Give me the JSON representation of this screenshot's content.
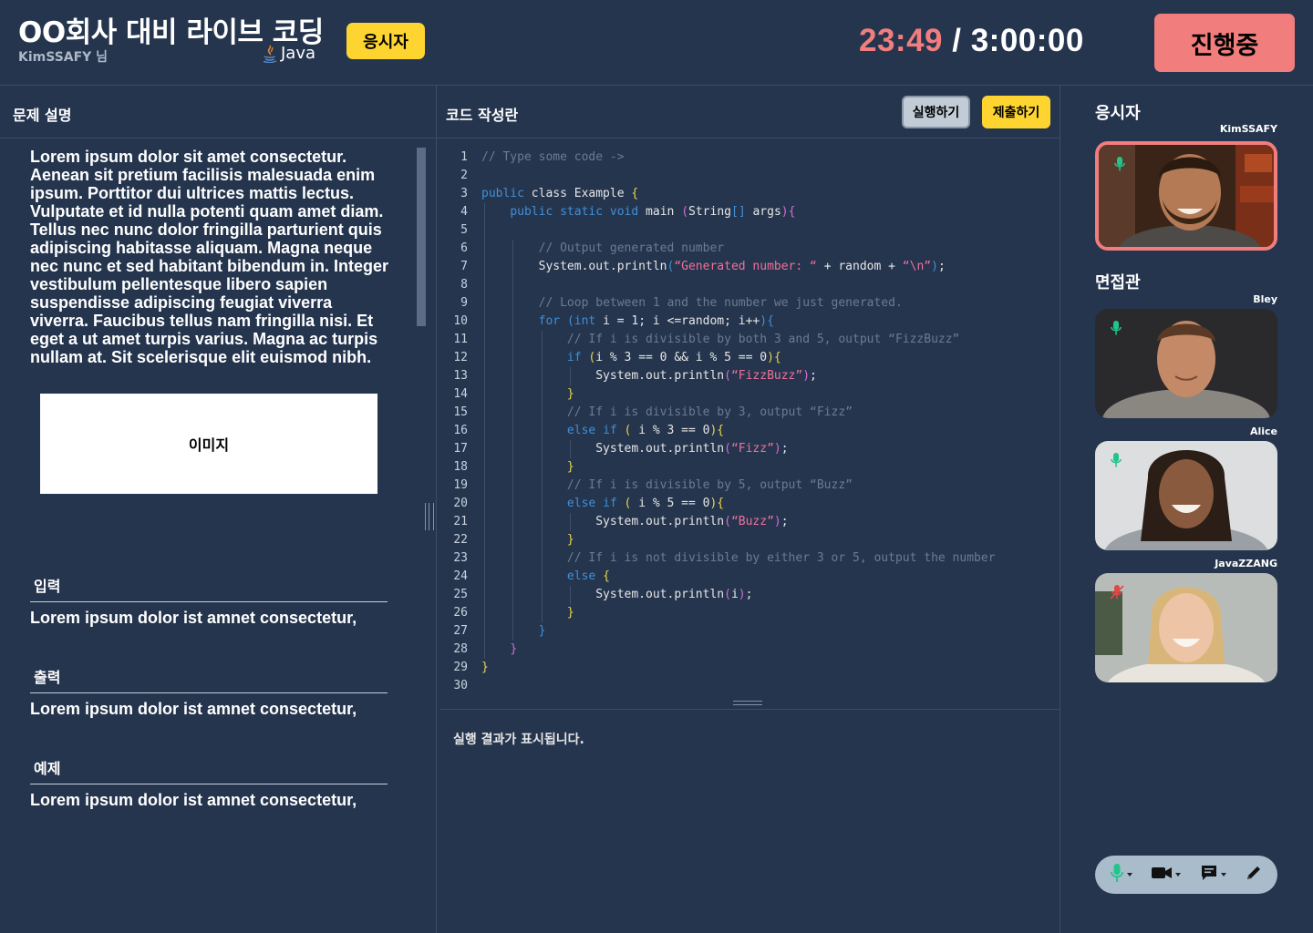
{
  "header": {
    "title": "OO회사 대비 라이브 코딩",
    "username": "KimSSAFY 님",
    "language": "Java",
    "role_badge": "응시자",
    "timer_elapsed": "23:49",
    "timer_separator": " / ",
    "timer_total": "3:00:00",
    "status_button": "진행중"
  },
  "problem": {
    "heading": "문제 설명",
    "description": "Lorem ipsum dolor sit amet consectetur. Aenean sit pretium facilisis malesuada enim ipsum. Porttitor dui ultrices mattis lectus. Vulputate et id nulla potenti quam amet diam. Tellus nec nunc dolor fringilla parturient quis adipiscing habitasse aliquam. Magna neque nec nunc et sed habitant bibendum in. Integer vestibulum pellentesque libero sapien suspendisse adipiscing feugiat viverra viverra. Faucibus tellus nam fringilla nisi. Et eget a ut amet turpis varius. Magna ac turpis nullam at. Sit scelerisque elit euismod nibh.",
    "image_label": "이미지",
    "input_heading": "입력",
    "input_text": "Lorem ipsum dolor ist amnet consectetur,",
    "output_heading": "출력",
    "output_text": "Lorem ipsum dolor ist amnet consectetur,",
    "example_heading": "예제",
    "example_text": "Lorem ipsum dolor ist amnet consectetur,"
  },
  "editor": {
    "heading": "코드 작성란",
    "run_button": "실행하기",
    "submit_button": "제출하기",
    "output_placeholder": "실행 결과가 표시됩니다.",
    "lines": [
      "// Type some code ->",
      "",
      "public class Example {",
      "    public static void main (String[] args){",
      "",
      "        // Output generated number",
      "        System.out.println(“Generated number: “ + random + “\\n”);",
      "",
      "        // Loop between 1 and the number we just generated.",
      "        for (int i = 1; i <=random; i++){",
      "            // If i is divisible by both 3 and 5, output “FizzBuzz”",
      "            if (i % 3 == 0 && i % 5 == 0){",
      "                System.out.println(“FizzBuzz”);",
      "            }",
      "            // If i is divisible by 3, output “Fizz”",
      "            else if ( i % 3 == 0){",
      "                System.out.println(“Fizz”);",
      "            }",
      "            // If i is divisible by 5, output “Buzz”",
      "            else if ( i % 5 == 0){",
      "                System.out.println(“Buzz”);",
      "            }",
      "            // If i is not divisible by either 3 or 5, output the number",
      "            else {",
      "                System.out.println(i);",
      "            }",
      "        }",
      "    }",
      "}",
      ""
    ]
  },
  "participants": {
    "candidate_heading": "응시자",
    "interviewer_heading": "면접관",
    "candidate": {
      "name": "KimSSAFY",
      "mic": "on"
    },
    "interviewers": [
      {
        "name": "Bley",
        "mic": "on"
      },
      {
        "name": "Alice",
        "mic": "on"
      },
      {
        "name": "JavaZZANG",
        "mic": "muted"
      }
    ]
  },
  "toolbar": {
    "items": [
      "mic-icon",
      "camera-icon",
      "chat-icon",
      "pen-icon"
    ]
  },
  "colors": {
    "background": "#25354e",
    "accent_yellow": "#fed530",
    "accent_red": "#f27d7d",
    "mic_on": "#21c48a",
    "mic_muted": "#e04848"
  }
}
